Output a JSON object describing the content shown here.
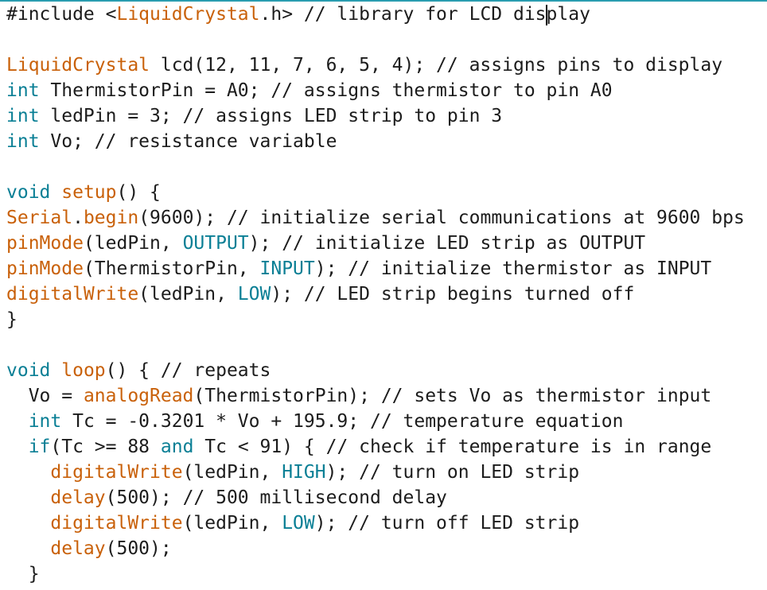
{
  "accent_color": "#2a9db0",
  "colors": {
    "keyword": "#0a7f95",
    "function": "#c9610a",
    "comment": "#555b5e",
    "text": "#1c1c1c"
  },
  "code_lines": [
    [
      {
        "t": "#include ",
        "k": "plain"
      },
      {
        "t": "<",
        "k": "plain"
      },
      {
        "t": "LiquidCrystal",
        "k": "fn"
      },
      {
        "t": ".h> // library for LCD dis",
        "k": "plain"
      },
      {
        "t": "|",
        "k": "cursor"
      },
      {
        "t": "play",
        "k": "plain"
      }
    ],
    [],
    [
      {
        "t": "LiquidCrystal",
        "k": "fn"
      },
      {
        "t": " lcd(12, 11, 7, 6, 5, 4); // assigns pins to display",
        "k": "plain"
      }
    ],
    [
      {
        "t": "int",
        "k": "kw"
      },
      {
        "t": " ThermistorPin = A0; // assigns thermistor to pin A0",
        "k": "plain"
      }
    ],
    [
      {
        "t": "int",
        "k": "kw"
      },
      {
        "t": " ledPin = 3; // assigns LED strip to pin 3",
        "k": "plain"
      }
    ],
    [
      {
        "t": "int",
        "k": "kw"
      },
      {
        "t": " Vo; // resistance variable",
        "k": "plain"
      }
    ],
    [],
    [
      {
        "t": "void",
        "k": "kw"
      },
      {
        "t": " ",
        "k": "plain"
      },
      {
        "t": "setup",
        "k": "fn"
      },
      {
        "t": "() {",
        "k": "plain"
      }
    ],
    [
      {
        "t": "Serial",
        "k": "fn"
      },
      {
        "t": ".",
        "k": "plain"
      },
      {
        "t": "begin",
        "k": "fn"
      },
      {
        "t": "(9600); // initialize serial communications at 9600 bps",
        "k": "plain"
      }
    ],
    [
      {
        "t": "pinMode",
        "k": "fn"
      },
      {
        "t": "(ledPin, ",
        "k": "plain"
      },
      {
        "t": "OUTPUT",
        "k": "kw"
      },
      {
        "t": "); // initialize LED strip as OUTPUT",
        "k": "plain"
      }
    ],
    [
      {
        "t": "pinMode",
        "k": "fn"
      },
      {
        "t": "(ThermistorPin, ",
        "k": "plain"
      },
      {
        "t": "INPUT",
        "k": "kw"
      },
      {
        "t": "); // initialize thermistor as INPUT",
        "k": "plain"
      }
    ],
    [
      {
        "t": "digitalWrite",
        "k": "fn"
      },
      {
        "t": "(ledPin, ",
        "k": "plain"
      },
      {
        "t": "LOW",
        "k": "kw"
      },
      {
        "t": "); // LED strip begins turned off",
        "k": "plain"
      }
    ],
    [
      {
        "t": "}",
        "k": "plain"
      }
    ],
    [],
    [
      {
        "t": "void",
        "k": "kw"
      },
      {
        "t": " ",
        "k": "plain"
      },
      {
        "t": "loop",
        "k": "fn"
      },
      {
        "t": "() { // repeats",
        "k": "plain"
      }
    ],
    [
      {
        "t": "  Vo = ",
        "k": "plain"
      },
      {
        "t": "analogRead",
        "k": "fn"
      },
      {
        "t": "(ThermistorPin); // sets Vo as thermistor input",
        "k": "plain"
      }
    ],
    [
      {
        "t": "  ",
        "k": "plain"
      },
      {
        "t": "int",
        "k": "kw"
      },
      {
        "t": " Tc = -0.3201 * Vo + 195.9; // temperature equation",
        "k": "plain"
      }
    ],
    [
      {
        "t": "  ",
        "k": "plain"
      },
      {
        "t": "if",
        "k": "kw"
      },
      {
        "t": "(Tc >= 88 ",
        "k": "plain"
      },
      {
        "t": "and",
        "k": "kw"
      },
      {
        "t": " Tc < 91) { // check if temperature is in range",
        "k": "plain"
      }
    ],
    [
      {
        "t": "    ",
        "k": "plain"
      },
      {
        "t": "digitalWrite",
        "k": "fn"
      },
      {
        "t": "(ledPin, ",
        "k": "plain"
      },
      {
        "t": "HIGH",
        "k": "kw"
      },
      {
        "t": "); // turn on LED strip",
        "k": "plain"
      }
    ],
    [
      {
        "t": "    ",
        "k": "plain"
      },
      {
        "t": "delay",
        "k": "fn"
      },
      {
        "t": "(500); // 500 millisecond delay",
        "k": "plain"
      }
    ],
    [
      {
        "t": "    ",
        "k": "plain"
      },
      {
        "t": "digitalWrite",
        "k": "fn"
      },
      {
        "t": "(ledPin, ",
        "k": "plain"
      },
      {
        "t": "LOW",
        "k": "kw"
      },
      {
        "t": "); // turn off LED strip",
        "k": "plain"
      }
    ],
    [
      {
        "t": "    ",
        "k": "plain"
      },
      {
        "t": "delay",
        "k": "fn"
      },
      {
        "t": "(500);",
        "k": "plain"
      }
    ],
    [
      {
        "t": "  }",
        "k": "plain"
      }
    ]
  ]
}
